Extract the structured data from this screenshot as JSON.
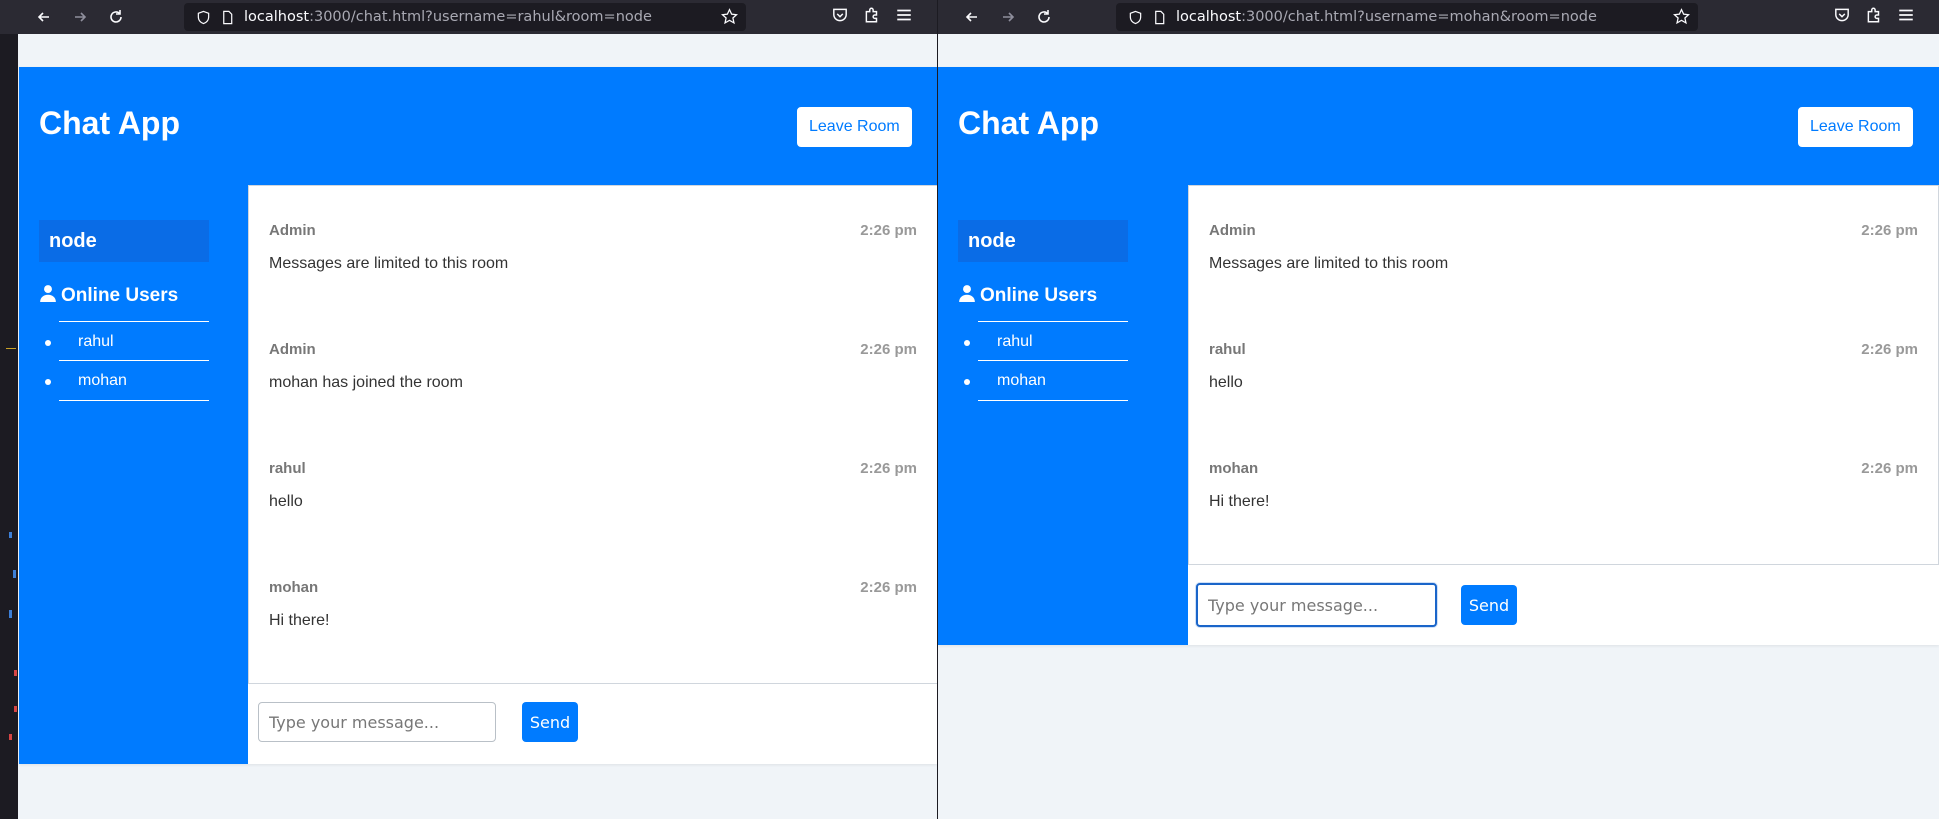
{
  "left": {
    "url_host": "localhost",
    "url_rest": ":3000/chat.html?username=rahul&room=node",
    "app_title": "Chat App",
    "leave_label": "Leave Room",
    "room": "node",
    "users_title": "Online Users",
    "users": [
      "rahul",
      "mohan"
    ],
    "messages": [
      {
        "user": "Admin",
        "time": "2:26 pm",
        "text": "Messages are limited to this room"
      },
      {
        "user": "Admin",
        "time": "2:26 pm",
        "text": "mohan has joined the room"
      },
      {
        "user": "rahul",
        "time": "2:26 pm",
        "text": "hello"
      },
      {
        "user": "mohan",
        "time": "2:26 pm",
        "text": "Hi there!"
      }
    ],
    "input_placeholder": "Type your message...",
    "send_label": "Send"
  },
  "right": {
    "url_host": "localhost",
    "url_rest": ":3000/chat.html?username=mohan&room=node",
    "app_title": "Chat App",
    "leave_label": "Leave Room",
    "room": "node",
    "users_title": "Online Users",
    "users": [
      "rahul",
      "mohan"
    ],
    "messages": [
      {
        "user": "Admin",
        "time": "2:26 pm",
        "text": "Messages are limited to this room"
      },
      {
        "user": "rahul",
        "time": "2:26 pm",
        "text": "hello"
      },
      {
        "user": "mohan",
        "time": "2:26 pm",
        "text": "Hi there!"
      }
    ],
    "input_placeholder": "Type your message...",
    "send_label": "Send"
  },
  "colors": {
    "brand": "#007bff",
    "browser_chrome": "#2b2a33",
    "page_bg": "#f0f4f8"
  },
  "icons": [
    "back-arrow-icon",
    "forward-arrow-icon",
    "reload-icon",
    "shield-icon",
    "page-icon",
    "star-icon",
    "pocket-icon",
    "extensions-icon",
    "menu-icon",
    "user-icon"
  ]
}
